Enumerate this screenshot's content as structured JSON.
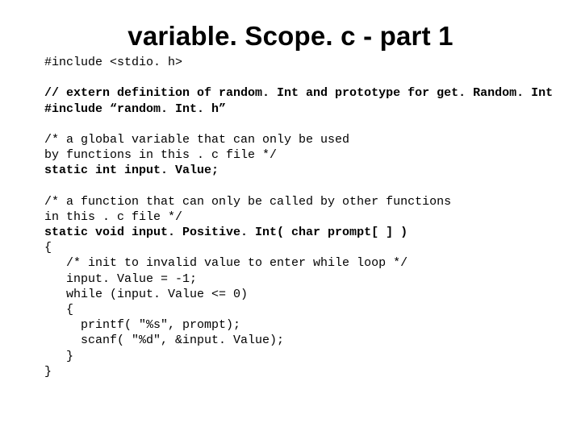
{
  "title": "variable. Scope. c - part 1",
  "lines": [
    {
      "t": "#include <stdio. h>",
      "b": false
    },
    {
      "t": "",
      "b": false
    },
    {
      "t": "// extern definition of random. Int and prototype for get. Random. Int",
      "b": true
    },
    {
      "t": "#include “random. Int. h”",
      "b": true
    },
    {
      "t": "",
      "b": false
    },
    {
      "t": "/* a global variable that can only be used",
      "b": false
    },
    {
      "t": "by functions in this . c file */",
      "b": false
    },
    {
      "t": "static int input. Value;",
      "b": true
    },
    {
      "t": "",
      "b": false
    },
    {
      "t": "/* a function that can only be called by other functions",
      "b": false
    },
    {
      "t": "in this . c file */",
      "b": false
    },
    {
      "t": "static void input. Positive. Int( char prompt[ ] )",
      "b": true
    },
    {
      "t": "{",
      "b": false
    },
    {
      "t": "   /* init to invalid value to enter while loop */",
      "b": false
    },
    {
      "t": "   input. Value = -1;",
      "b": false
    },
    {
      "t": "   while (input. Value <= 0)",
      "b": false
    },
    {
      "t": "   {",
      "b": false
    },
    {
      "t": "     printf( \"%s\", prompt);",
      "b": false
    },
    {
      "t": "     scanf( \"%d\", &input. Value);",
      "b": false
    },
    {
      "t": "   }",
      "b": false
    },
    {
      "t": "}",
      "b": false
    }
  ]
}
